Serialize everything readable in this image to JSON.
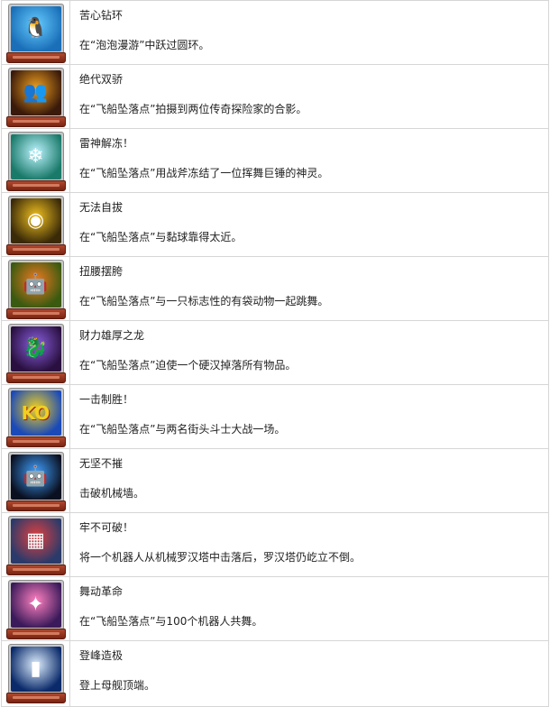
{
  "trophies": [
    {
      "title": "苦心钻环",
      "desc": "在“泡泡漫游”中跃过圆环。",
      "icon": "penguin-icon",
      "color_a": "#1a6fb8",
      "color_b": "#66ccff",
      "glyph": "🐧"
    },
    {
      "title": "绝代双骄",
      "desc": "在“飞船坠落点”拍摄到两位传奇探险家的合影。",
      "icon": "two-explorers-icon",
      "color_a": "#3a1a0a",
      "color_b": "#f0a020",
      "glyph": "👥"
    },
    {
      "title": "雷神解冻！",
      "desc": "在“飞船坠落点”用战斧冻结了一位挥舞巨锤的神灵。",
      "icon": "frozen-god-icon",
      "color_a": "#1a7a6a",
      "color_b": "#bdf4ff",
      "glyph": "❄"
    },
    {
      "title": "无法自拔",
      "desc": "在“飞船坠落点”与黏球靠得太近。",
      "icon": "sticky-ball-icon",
      "color_a": "#3a2a08",
      "color_b": "#f0c020",
      "glyph": "◉"
    },
    {
      "title": "扭腰摆胯",
      "desc": "在“飞船坠落点”与一只标志性的有袋动物一起跳舞。",
      "icon": "dancing-robot-icon",
      "color_a": "#3a5a10",
      "color_b": "#f07a20",
      "glyph": "🤖"
    },
    {
      "title": "财力雄厚之龙",
      "desc": "在“飞船坠落点”迫使一个硬汉掉落所有物品。",
      "icon": "dragon-icon",
      "color_a": "#2a1040",
      "color_b": "#8a60e0",
      "glyph": "🐉"
    },
    {
      "title": "一击制胜！",
      "desc": "在“飞船坠落点”与两名街头斗士大战一场。",
      "icon": "ko-burst-icon",
      "color_a": "#1a4ab8",
      "color_b": "#f0d020",
      "glyph": "KO"
    },
    {
      "title": "无坚不摧",
      "desc": "击破机械墙。",
      "icon": "robot-spotlight-icon",
      "color_a": "#0a1020",
      "color_b": "#40a0ff",
      "glyph": "🤖"
    },
    {
      "title": "牢不可破！",
      "desc": "将一个机器人从机械罗汉塔中击落后，罗汉塔仍屹立不倒。",
      "icon": "robot-tower-icon",
      "color_a": "#2a3a6a",
      "color_b": "#e04040",
      "glyph": "▦"
    },
    {
      "title": "舞动革命",
      "desc": "在“飞船坠落点”与100个机器人共舞。",
      "icon": "dance-crowd-icon",
      "color_a": "#3a1a5a",
      "color_b": "#ff80c0",
      "glyph": "✦"
    },
    {
      "title": "登峰造极",
      "desc": "登上母舰顶端。",
      "icon": "tower-beam-icon",
      "color_a": "#0a2a6a",
      "color_b": "#e0f0ff",
      "glyph": "▮"
    }
  ]
}
